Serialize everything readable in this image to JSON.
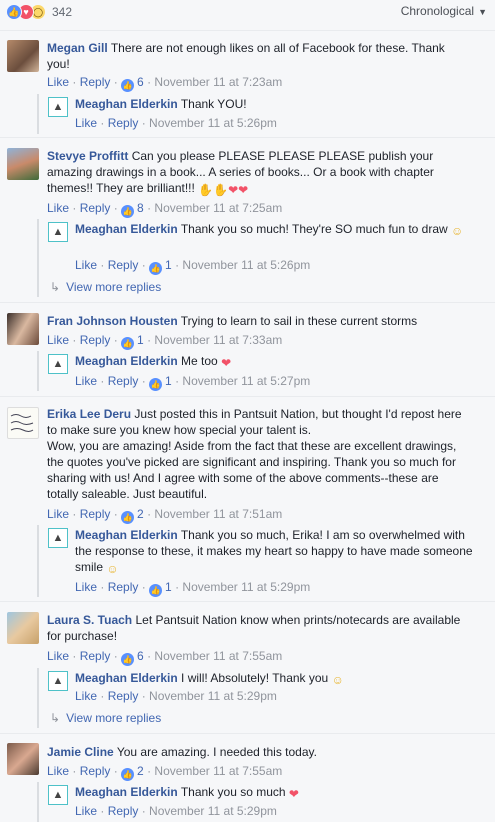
{
  "header": {
    "reaction_count": "342",
    "sort_label": "Chronological",
    "reaction_icons": [
      "like-icon",
      "love-icon",
      "wow-icon"
    ]
  },
  "labels": {
    "like": "Like",
    "reply": "Reply",
    "sep": "·",
    "view_more": "View more replies"
  },
  "comments": [
    {
      "author": "Megan Gill",
      "text": "There are not enough likes on all of Facebook for these. Thank you!",
      "likes": "6",
      "time": "November 11 at 7:23am",
      "reply": {
        "author": "Meaghan Elderkin",
        "text": "Thank YOU!",
        "likes": "",
        "time": "November 11 at 5:26pm"
      }
    },
    {
      "author": "Stevye Proffitt",
      "text": "Can you please PLEASE PLEASE PLEASE publish your amazing drawings in a book... A series of books... Or a book with chapter themes!! They are brilliant!!!",
      "likes": "8",
      "time": "November 11 at 7:25am",
      "reply": {
        "author": "Meaghan Elderkin",
        "text": "Thank you so much! They're SO much fun to draw",
        "likes": "1",
        "time": "November 11 at 5:26pm"
      }
    },
    {
      "author": "Fran Johnson Housten",
      "text": "Trying to learn to sail in these current storms",
      "likes": "1",
      "time": "November 11 at 7:33am",
      "reply": {
        "author": "Meaghan Elderkin",
        "text": "Me too",
        "likes": "1",
        "time": "November 11 at 5:27pm"
      }
    },
    {
      "author": "Erika Lee Deru",
      "text": "Just posted this in Pantsuit Nation, but thought I'd repost here to make sure you knew how special your talent is.",
      "text2": "Wow, you are amazing! Aside from the fact that these are excellent drawings, the quotes you've picked are significant and inspiring. Thank you so much for sharing with us! And I agree with some of the above comments--these are totally saleable. Just beautiful.",
      "likes": "2",
      "time": "November 11 at 7:51am",
      "reply": {
        "author": "Meaghan Elderkin",
        "text": "Thank you so much, Erika! I am so overwhelmed with the response to these, it makes my heart so happy to have made someone smile",
        "likes": "1",
        "time": "November 11 at 5:29pm"
      }
    },
    {
      "author": "Laura S. Tuach",
      "text": "Let Pantsuit Nation know when prints/notecards are available for purchase!",
      "likes": "6",
      "time": "November 11 at 7:55am",
      "reply": {
        "author": "Meaghan Elderkin",
        "text": "I will! Absolutely! Thank you",
        "likes": "",
        "time": "November 11 at 5:29pm"
      }
    },
    {
      "author": "Jamie Cline",
      "text": "You are amazing. I needed this today.",
      "likes": "2",
      "time": "November 11 at 7:55am",
      "reply": {
        "author": "Meaghan Elderkin",
        "text": "Thank you so much",
        "likes": "",
        "time": "November 11 at 5:29pm"
      }
    }
  ]
}
